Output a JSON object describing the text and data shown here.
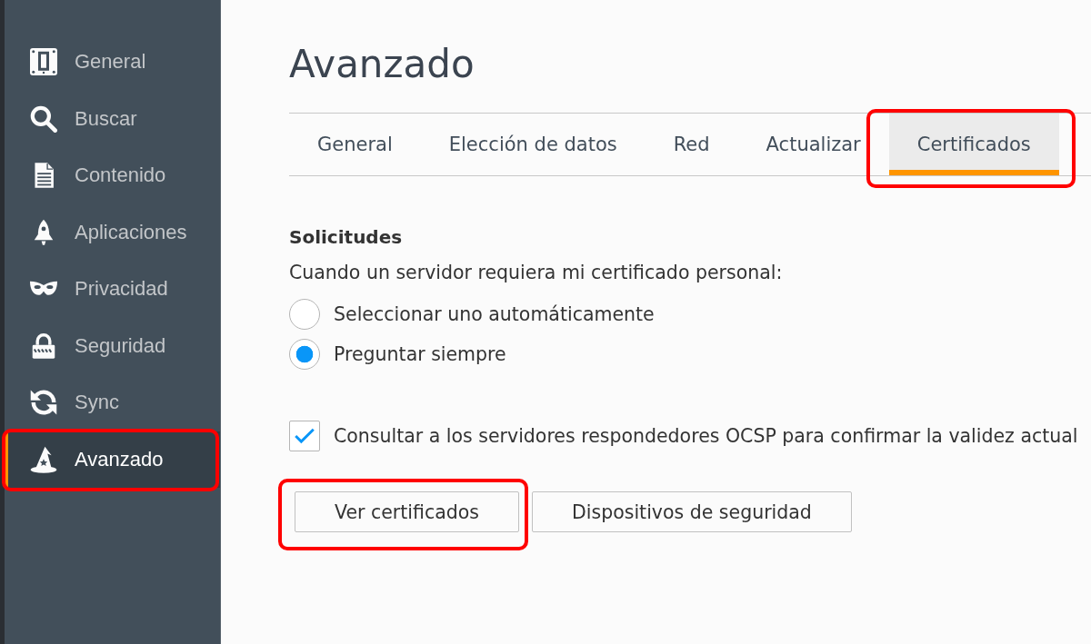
{
  "sidebar": {
    "items": [
      {
        "label": "General",
        "selected": false,
        "highlighted": false
      },
      {
        "label": "Buscar",
        "selected": false,
        "highlighted": false
      },
      {
        "label": "Contenido",
        "selected": false,
        "highlighted": false
      },
      {
        "label": "Aplicaciones",
        "selected": false,
        "highlighted": false
      },
      {
        "label": "Privacidad",
        "selected": false,
        "highlighted": false
      },
      {
        "label": "Seguridad",
        "selected": false,
        "highlighted": false
      },
      {
        "label": "Sync",
        "selected": false,
        "highlighted": false
      },
      {
        "label": "Avanzado",
        "selected": true,
        "highlighted": true
      }
    ]
  },
  "page_title": "Avanzado",
  "tabs": [
    {
      "label": "General",
      "selected": false,
      "highlighted": false
    },
    {
      "label": "Elección de datos",
      "selected": false,
      "highlighted": false
    },
    {
      "label": "Red",
      "selected": false,
      "highlighted": false
    },
    {
      "label": "Actualizar",
      "selected": false,
      "highlighted": false
    },
    {
      "label": "Certificados",
      "selected": true,
      "highlighted": true
    }
  ],
  "requests": {
    "heading": "Solicitudes",
    "prompt": "Cuando un servidor requiera mi certificado personal:",
    "options": [
      {
        "label": "Seleccionar uno automáticamente",
        "selected": false
      },
      {
        "label": "Preguntar siempre",
        "selected": true
      }
    ]
  },
  "ocsp": {
    "label": "Consultar a los servidores respondedores OCSP para confirmar la validez actual",
    "checked": true
  },
  "buttons": [
    {
      "label": "Ver certificados",
      "highlighted": true
    },
    {
      "label": "Dispositivos de seguridad",
      "highlighted": false
    }
  ]
}
